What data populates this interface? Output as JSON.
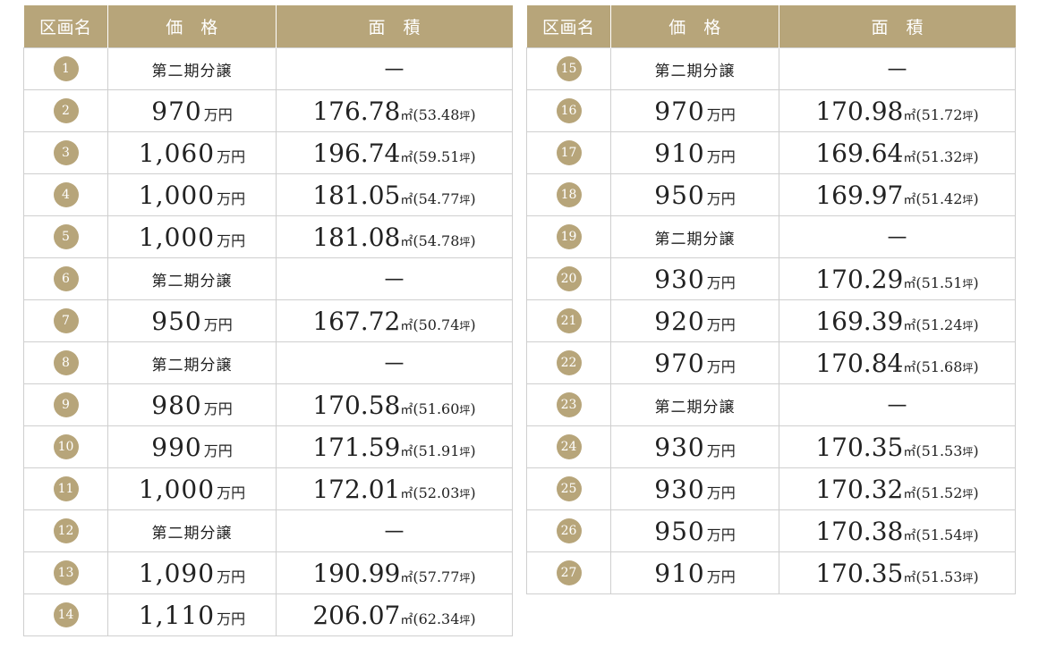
{
  "headers": {
    "lot": "区画名",
    "price": "価　格",
    "area": "面　積"
  },
  "units": {
    "price": "万円",
    "sqm": "㎡",
    "tsubo": "坪",
    "open_paren": "(",
    "close_paren": ")"
  },
  "pending_label": "第二期分譲",
  "dash": "—",
  "theme": {
    "gold": "#b7a57a"
  },
  "left_rows": [
    {
      "no": "1",
      "pending": true
    },
    {
      "no": "2",
      "price": "970",
      "sqm": "176.78",
      "tsubo": "53.48"
    },
    {
      "no": "3",
      "price": "1,060",
      "sqm": "196.74",
      "tsubo": "59.51"
    },
    {
      "no": "4",
      "price": "1,000",
      "sqm": "181.05",
      "tsubo": "54.77"
    },
    {
      "no": "5",
      "price": "1,000",
      "sqm": "181.08",
      "tsubo": "54.78"
    },
    {
      "no": "6",
      "pending": true
    },
    {
      "no": "7",
      "price": "950",
      "sqm": "167.72",
      "tsubo": "50.74"
    },
    {
      "no": "8",
      "pending": true
    },
    {
      "no": "9",
      "price": "980",
      "sqm": "170.58",
      "tsubo": "51.60"
    },
    {
      "no": "10",
      "price": "990",
      "sqm": "171.59",
      "tsubo": "51.91"
    },
    {
      "no": "11",
      "price": "1,000",
      "sqm": "172.01",
      "tsubo": "52.03"
    },
    {
      "no": "12",
      "pending": true
    },
    {
      "no": "13",
      "price": "1,090",
      "sqm": "190.99",
      "tsubo": "57.77"
    },
    {
      "no": "14",
      "price": "1,110",
      "sqm": "206.07",
      "tsubo": "62.34"
    }
  ],
  "right_rows": [
    {
      "no": "15",
      "pending": true
    },
    {
      "no": "16",
      "price": "970",
      "sqm": "170.98",
      "tsubo": "51.72"
    },
    {
      "no": "17",
      "price": "910",
      "sqm": "169.64",
      "tsubo": "51.32"
    },
    {
      "no": "18",
      "price": "950",
      "sqm": "169.97",
      "tsubo": "51.42"
    },
    {
      "no": "19",
      "pending": true
    },
    {
      "no": "20",
      "price": "930",
      "sqm": "170.29",
      "tsubo": "51.51"
    },
    {
      "no": "21",
      "price": "920",
      "sqm": "169.39",
      "tsubo": "51.24"
    },
    {
      "no": "22",
      "price": "970",
      "sqm": "170.84",
      "tsubo": "51.68"
    },
    {
      "no": "23",
      "pending": true
    },
    {
      "no": "24",
      "price": "930",
      "sqm": "170.35",
      "tsubo": "51.53"
    },
    {
      "no": "25",
      "price": "930",
      "sqm": "170.32",
      "tsubo": "51.52"
    },
    {
      "no": "26",
      "price": "950",
      "sqm": "170.38",
      "tsubo": "51.54"
    },
    {
      "no": "27",
      "price": "910",
      "sqm": "170.35",
      "tsubo": "51.53"
    }
  ]
}
